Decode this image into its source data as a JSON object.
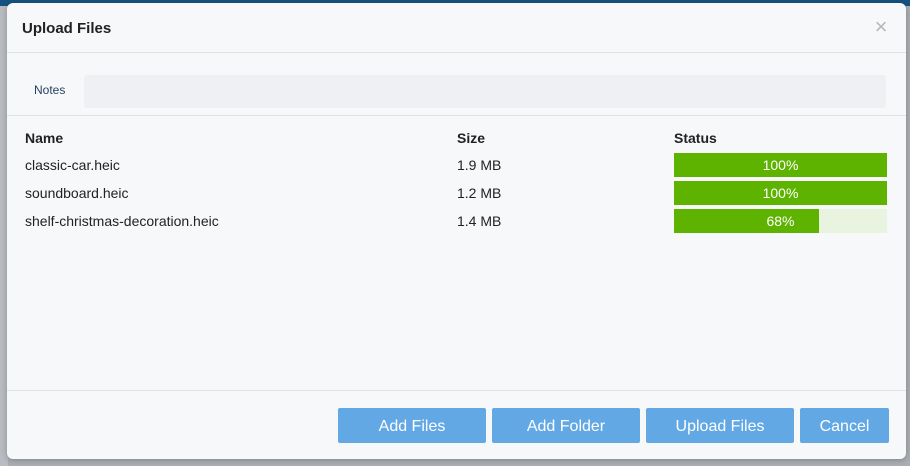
{
  "dialog": {
    "title": "Upload Files",
    "close_symbol": "×"
  },
  "notes": {
    "label": "Notes",
    "value": ""
  },
  "table": {
    "headers": {
      "name": "Name",
      "size": "Size",
      "status": "Status"
    },
    "rows": [
      {
        "name": "classic-car.heic",
        "size": "1.9 MB",
        "progress_label": "100%",
        "progress": 1.0
      },
      {
        "name": "soundboard.heic",
        "size": "1.2 MB",
        "progress_label": "100%",
        "progress": 1.0
      },
      {
        "name": "shelf-christmas-decoration.heic",
        "size": "1.4 MB",
        "progress_label": "68%",
        "progress": 0.68
      }
    ]
  },
  "buttons": {
    "add_files": "Add Files",
    "add_folder": "Add Folder",
    "upload_files": "Upload Files",
    "cancel": "Cancel"
  },
  "colors": {
    "progress_fill": "#5db300",
    "progress_track": "#e8f4e0",
    "button_bg": "#62a8e5"
  }
}
